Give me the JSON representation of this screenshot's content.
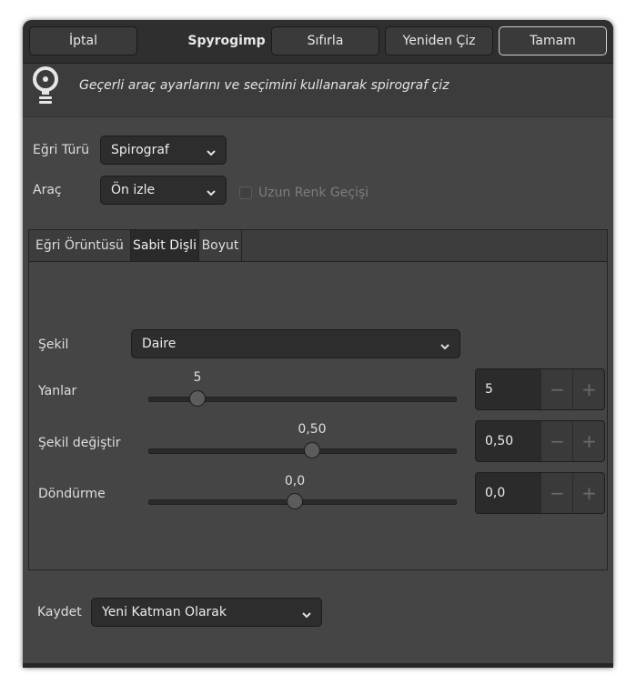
{
  "header": {
    "cancel_label": "İptal",
    "title": "Spyrogimp",
    "reset_label": "Sıfırla",
    "redraw_label": "Yeniden Çiz",
    "ok_label": "Tamam"
  },
  "info": {
    "description": "Geçerli araç ayarlarını ve seçimini kullanarak spirograf çiz",
    "icon": "lightbulb-icon"
  },
  "curve_type": {
    "label": "Eğri Türü",
    "value": "Spirograf"
  },
  "tool": {
    "label": "Araç",
    "value": "Ön izle"
  },
  "long_gradient": {
    "label": "Uzun Renk Geçişi",
    "checked": false,
    "enabled": false
  },
  "tabs": [
    {
      "label": "Eğri Örüntüsü",
      "active": false
    },
    {
      "label": "Sabit Dişli",
      "active": true
    },
    {
      "label": "Boyut",
      "active": false
    }
  ],
  "fixed_gear": {
    "shape": {
      "label": "Şekil",
      "value": "Daire"
    },
    "sides": {
      "label": "Yanlar",
      "value": "5",
      "level": 0.18
    },
    "morph": {
      "label": "Şekil değiştir",
      "value": "0,50",
      "level": 0.55
    },
    "rotation": {
      "label": "Döndürme",
      "value": "0,0",
      "level": 0.5
    }
  },
  "save": {
    "label": "Kaydet",
    "value": "Yeni Katman Olarak"
  },
  "colors": {
    "window_bg": "#454545",
    "header_bg": "#2f2f2f",
    "entry_bg": "#2b2b2b"
  }
}
